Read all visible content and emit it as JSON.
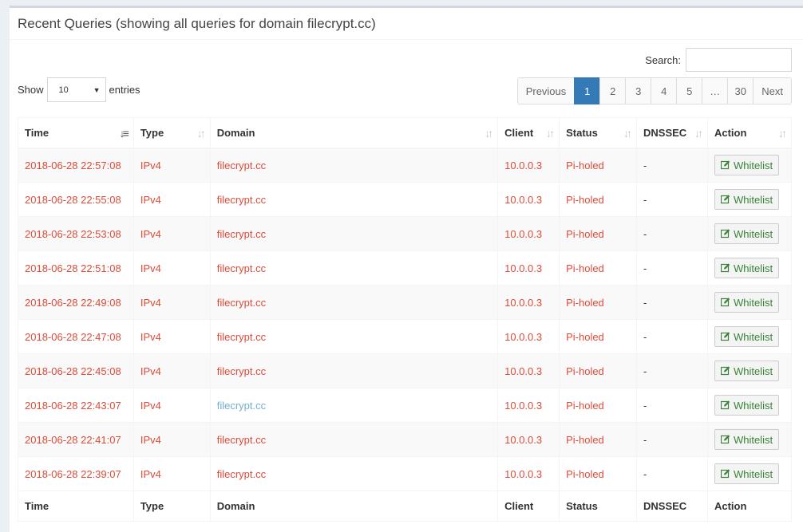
{
  "title": "Recent Queries (showing all queries for domain filecrypt.cc)",
  "search": {
    "label": "Search:",
    "value": ""
  },
  "length": {
    "show_label": "Show",
    "value": "10",
    "entries_label": "entries"
  },
  "pagination": {
    "previous": "Previous",
    "pages": [
      "1",
      "2",
      "3",
      "4",
      "5",
      "…",
      "30"
    ],
    "active": "1",
    "next": "Next"
  },
  "table": {
    "columns": [
      "Time",
      "Type",
      "Domain",
      "Client",
      "Status",
      "DNSSEC",
      "Action"
    ],
    "sorted_column": "Time",
    "action_label": "Whitelist",
    "rows": [
      {
        "time": "2018-06-28 22:57:08",
        "type": "IPv4",
        "domain": "filecrypt.cc",
        "client": "10.0.0.3",
        "status": "Pi-holed",
        "dnssec": "-",
        "domain_color": "#dd4b39"
      },
      {
        "time": "2018-06-28 22:55:08",
        "type": "IPv4",
        "domain": "filecrypt.cc",
        "client": "10.0.0.3",
        "status": "Pi-holed",
        "dnssec": "-",
        "domain_color": "#dd4b39"
      },
      {
        "time": "2018-06-28 22:53:08",
        "type": "IPv4",
        "domain": "filecrypt.cc",
        "client": "10.0.0.3",
        "status": "Pi-holed",
        "dnssec": "-",
        "domain_color": "#dd4b39"
      },
      {
        "time": "2018-06-28 22:51:08",
        "type": "IPv4",
        "domain": "filecrypt.cc",
        "client": "10.0.0.3",
        "status": "Pi-holed",
        "dnssec": "-",
        "domain_color": "#dd4b39"
      },
      {
        "time": "2018-06-28 22:49:08",
        "type": "IPv4",
        "domain": "filecrypt.cc",
        "client": "10.0.0.3",
        "status": "Pi-holed",
        "dnssec": "-",
        "domain_color": "#dd4b39"
      },
      {
        "time": "2018-06-28 22:47:08",
        "type": "IPv4",
        "domain": "filecrypt.cc",
        "client": "10.0.0.3",
        "status": "Pi-holed",
        "dnssec": "-",
        "domain_color": "#dd4b39"
      },
      {
        "time": "2018-06-28 22:45:08",
        "type": "IPv4",
        "domain": "filecrypt.cc",
        "client": "10.0.0.3",
        "status": "Pi-holed",
        "dnssec": "-",
        "domain_color": "#dd4b39"
      },
      {
        "time": "2018-06-28 22:43:07",
        "type": "IPv4",
        "domain": "filecrypt.cc",
        "client": "10.0.0.3",
        "status": "Pi-holed",
        "dnssec": "-",
        "domain_color": "#72afd2"
      },
      {
        "time": "2018-06-28 22:41:07",
        "type": "IPv4",
        "domain": "filecrypt.cc",
        "client": "10.0.0.3",
        "status": "Pi-holed",
        "dnssec": "-",
        "domain_color": "#dd4b39"
      },
      {
        "time": "2018-06-28 22:39:07",
        "type": "IPv4",
        "domain": "filecrypt.cc",
        "client": "10.0.0.3",
        "status": "Pi-holed",
        "dnssec": "-",
        "domain_color": "#dd4b39"
      }
    ]
  },
  "colors": {
    "blocked_text": "#dd4b39",
    "link_text": "#72afd2",
    "active_page": "#337ab7",
    "whitelist_text": "#398439"
  }
}
